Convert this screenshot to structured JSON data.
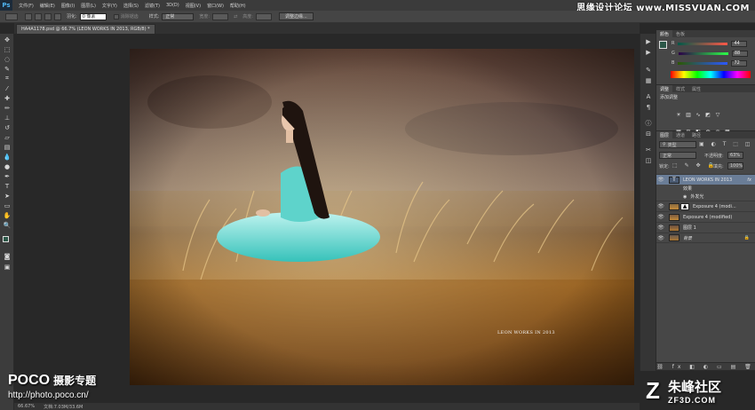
{
  "app": {
    "logo": "Ps"
  },
  "menu": [
    "文件(F)",
    "编辑(E)",
    "图像(I)",
    "图层(L)",
    "文字(Y)",
    "选择(S)",
    "滤镜(T)",
    "3D(D)",
    "视图(V)",
    "窗口(W)",
    "帮助(H)"
  ],
  "watermark": "思缘设计论坛 www.MISSVUAN.COM",
  "options": {
    "feather_label": "羽化:",
    "feather_value": "0 像素",
    "antialias_label": "消除锯齿",
    "style_label": "样式:",
    "style_value": "正常",
    "width_label": "宽度:",
    "height_label": "高度:",
    "refine_button": "调整边缘..."
  },
  "document": {
    "tab_label": "HA4A1178.psd @ 66.7% (LEON WORKS IN 2013, RGB/8) *",
    "photo_caption": "LEON WORKS IN 2013"
  },
  "status": {
    "zoom": "66.67%",
    "doc_info": "文档:7.03M/33.6M"
  },
  "branding": {
    "poco_logo": "POCO",
    "poco_title": "摄影专题",
    "poco_url": "http://photo.poco.cn/",
    "zf_logo": "Z",
    "zf_name": "朱峰社区",
    "zf_site": "ZF3D.COM"
  },
  "color_panel": {
    "tabs": [
      "颜色",
      "色板"
    ],
    "channels": [
      {
        "label": "R",
        "value": "44"
      },
      {
        "label": "G",
        "value": "88"
      },
      {
        "label": "B",
        "value": "72"
      }
    ],
    "foreground": "#2c5848"
  },
  "adjust_panel": {
    "tabs": [
      "调整",
      "样式",
      "属性"
    ],
    "add_label": "添加调整"
  },
  "layers_panel": {
    "tabs": [
      "图层",
      "通道",
      "路径"
    ],
    "filter_label": "类型",
    "blend_mode": "正常",
    "opacity_label": "不透明度:",
    "opacity_value": "63%",
    "lock_label": "锁定:",
    "fill_label": "填充:",
    "fill_value": "100%",
    "layers": [
      {
        "name": "LEON WORKS IN 2013",
        "kind": "text",
        "selected": true,
        "fx": "fx"
      },
      {
        "name": "效果",
        "kind": "effect"
      },
      {
        "name": "外发光",
        "kind": "effect"
      },
      {
        "name": "Exposure 4 (modi...",
        "kind": "adjust"
      },
      {
        "name": "Exposure 4 (modified)",
        "kind": "image"
      },
      {
        "name": "图层 1",
        "kind": "image"
      },
      {
        "name": "背景",
        "kind": "background",
        "locked": true
      }
    ]
  }
}
